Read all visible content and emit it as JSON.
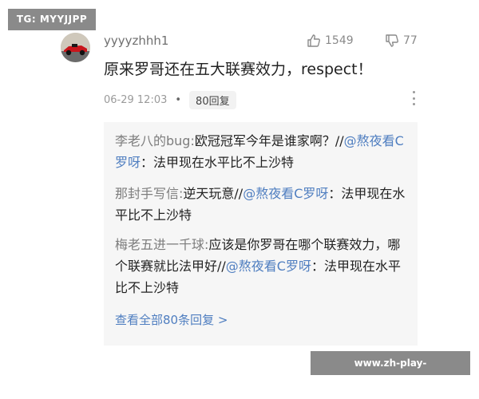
{
  "watermark_top": "TG: MYYJJPP",
  "comment": {
    "username": "yyyyzhhh1",
    "likes": "1549",
    "dislikes": "77",
    "text": "原来罗哥还在五大联赛效力，respect！",
    "date": "06-29 12:03",
    "replies_label": "80回复"
  },
  "replies": [
    {
      "author": "李老八的bug:",
      "text_a": "欧冠冠军今年是谁家啊？//",
      "mention": "@熬夜看C罗呀",
      "text_b": "：法甲现在水平比不上沙特"
    },
    {
      "author": "那封手写信:",
      "text_a": "逆天玩意//",
      "mention": "@熬夜看C罗呀",
      "text_b": "：法甲现在水平比不上沙特"
    },
    {
      "author": "梅老五进一千球:",
      "text_a": "应该是你罗哥在哪个联赛效力，哪个联赛就比法甲好//",
      "mention": "@熬夜看C罗呀",
      "text_b": "：法甲现在水平比不上沙特"
    }
  ],
  "view_all": "查看全部80条回复 >",
  "watermark_bottom": "www.zh-play-milansports.com",
  "colors": {
    "mention": "#4f7ec0",
    "reply_bg": "#f6f6f6",
    "badge_bg": "#8a8a8a"
  }
}
